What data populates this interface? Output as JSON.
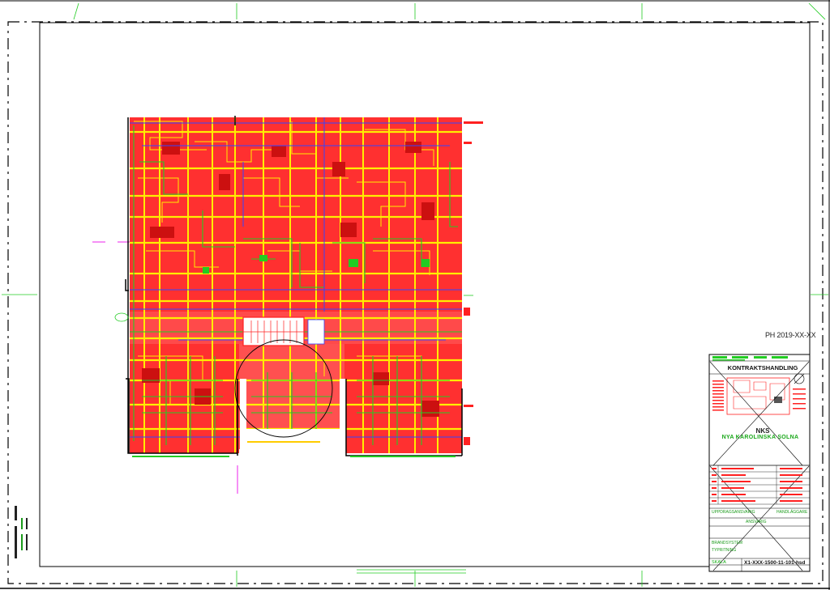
{
  "drawing": {
    "reference_id": "PH 2019-XX-XX",
    "status_title": "KONTRAKTSHANDLING",
    "project_code": "NKS",
    "project_name": "NYA KAROLINSKA SOLNA",
    "drawing_number": "X1-XXX-1500-11-101-hsd",
    "scale_label": "SKALA",
    "role_labels": [
      "UPPDRAGSANSVARIG",
      "HANDLÄGGARE",
      "ANSVARIG"
    ],
    "discipline_labels": [
      "BRANDSYSTEM",
      "TYPRITNING"
    ]
  },
  "colors": {
    "primary_linework": "#ff2020",
    "secondary_linework": "#ffee00",
    "tertiary_linework": "#22cc22",
    "accent_linework": "#3344ff",
    "highlight": "#ee22ee",
    "frame": "#000000",
    "grid_marker": "#22cc22"
  }
}
